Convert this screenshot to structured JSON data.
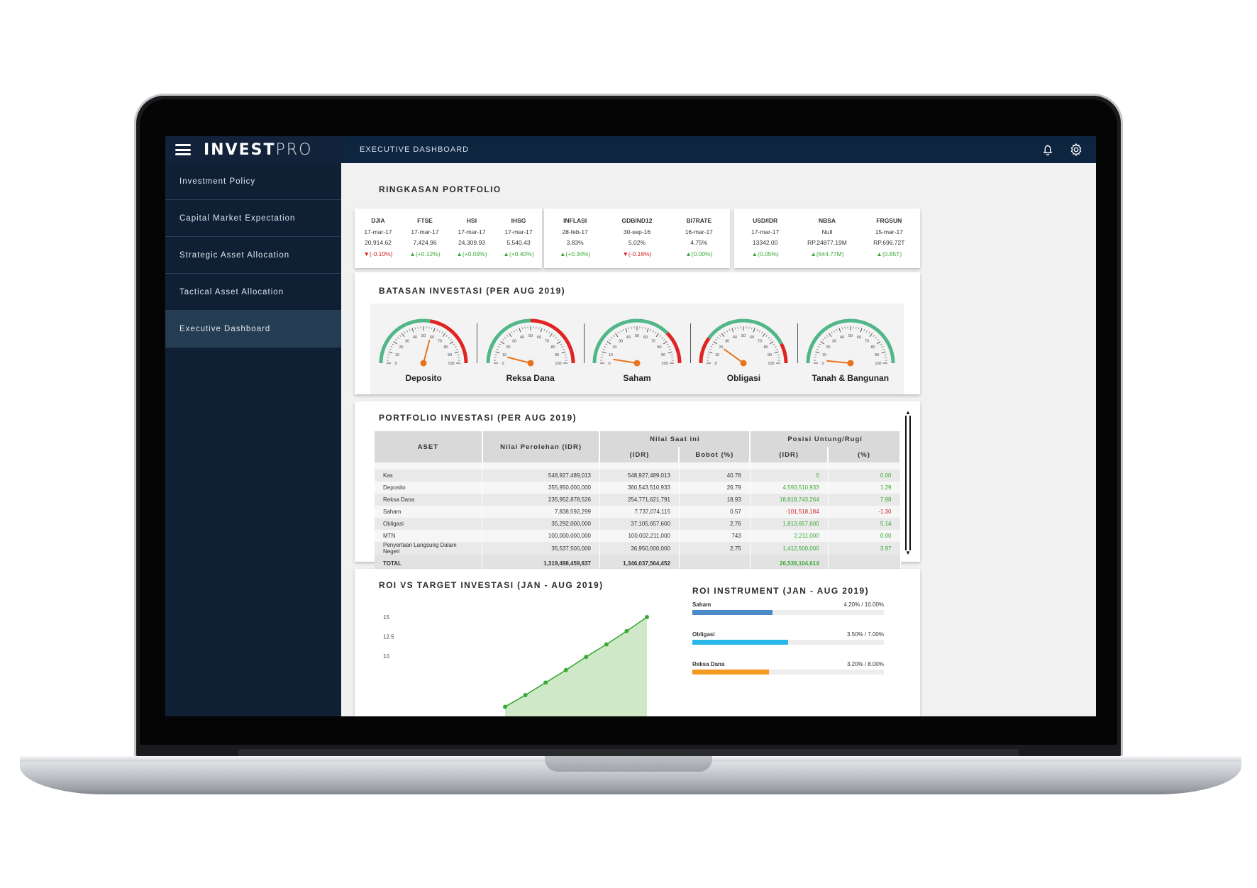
{
  "app": {
    "brand_bold": "INVEST",
    "brand_light": "PRO",
    "page_title": "EXECUTIVE DASHBOARD"
  },
  "icons": {
    "menu": "hamburger-icon",
    "notifications": "bell-icon",
    "settings": "gear-icon"
  },
  "sidebar": {
    "items": [
      {
        "label": "Investment Policy"
      },
      {
        "label": "Capital Market Expectation"
      },
      {
        "label": "Strategic Asset Allocation"
      },
      {
        "label": "Tactical Asset Allocation"
      },
      {
        "label": "Executive Dashboard",
        "active": true
      }
    ]
  },
  "ringkasan": {
    "title": "RINGKASAN PORTFOLIO",
    "groups": [
      [
        {
          "name": "DJIA",
          "date": "17-mar-17",
          "value": "20,914.62",
          "change": "(-0.10%)",
          "dir": "down"
        },
        {
          "name": "FTSE",
          "date": "17-mar-17",
          "value": "7,424.96",
          "change": "(+0.12%)",
          "dir": "up"
        },
        {
          "name": "HSI",
          "date": "17-mar-17",
          "value": "24,309.93",
          "change": "(+0.09%)",
          "dir": "up"
        },
        {
          "name": "IHSG",
          "date": "17-mar-17",
          "value": "5,540.43",
          "change": "(+0.40%)",
          "dir": "up"
        }
      ],
      [
        {
          "name": "INFLASI",
          "date": "28-feb-17",
          "value": "3.83%",
          "change": "(+0.34%)",
          "dir": "up"
        },
        {
          "name": "GDBIND12",
          "date": "30-sep-16",
          "value": "5.02%",
          "change": "(-0.16%)",
          "dir": "down"
        },
        {
          "name": "BI7RATE",
          "date": "16-mar-17",
          "value": "4.75%",
          "change": "(0.00%)",
          "dir": "up"
        }
      ],
      [
        {
          "name": "USD/IDR",
          "date": "17-mar-17",
          "value": "13342.00",
          "change": "(0.05%)",
          "dir": "up"
        },
        {
          "name": "NBSA",
          "date": "Null",
          "value": "RP.24877.19M",
          "change": "(644.77M)",
          "dir": "up"
        },
        {
          "name": "FRGSUN",
          "date": "15-mar-17",
          "value": "RP.696.72T",
          "change": "(0.85T)",
          "dir": "up"
        }
      ]
    ]
  },
  "batasan": {
    "title": "BATASAN INVESTASI (PER AUG 2019)",
    "ticks": [
      "0",
      "10",
      "20",
      "30",
      "40",
      "50",
      "60",
      "70",
      "80",
      "90",
      "100"
    ],
    "colors": {
      "green": "#52b788",
      "red": "#e02424",
      "needle": "#e8731a"
    },
    "gauges": [
      {
        "label": "Deposito",
        "value": 58,
        "green_to": 55
      },
      {
        "label": "Reksa Dana",
        "value": 8,
        "green_to": 50
      },
      {
        "label": "Saham",
        "value": 5,
        "green_to": 75
      },
      {
        "label": "Obligasi",
        "value": 20,
        "green_to": 85,
        "red_left_to": 20
      },
      {
        "label": "Tanah & Bangunan",
        "value": 3,
        "green_to": 100
      }
    ]
  },
  "portfolio": {
    "title": "PORTFOLIO INVESTASI (PER AUG 2019)",
    "headers": {
      "aset": "ASET",
      "nilai_perolehan": "Nilai Perolehan (IDR)",
      "nilai_saat_ini": "Nilai Saat ini",
      "posisi": "Posisi Untung/Rugi",
      "idr": "(IDR)",
      "bobot": "Bobot (%)",
      "pct": "(%)"
    },
    "rows": [
      {
        "aset": "Kas",
        "perolehan": "548,927,489,013",
        "saat_ini": "548,927,489,013",
        "bobot": "40.78",
        "idr": "0",
        "pct": "0.00",
        "sign": "up"
      },
      {
        "aset": "Deposito",
        "perolehan": "355,950,000,000",
        "saat_ini": "360,543,510,933",
        "bobot": "26.79",
        "idr": "4,593,510,933",
        "pct": "1.29",
        "sign": "up"
      },
      {
        "aset": "Reksa Dana",
        "perolehan": "235,952,878,526",
        "saat_ini": "254,771,621,791",
        "bobot": "18.93",
        "idr": "18,818,743,264",
        "pct": "7.98",
        "sign": "up"
      },
      {
        "aset": "Saham",
        "perolehan": "7,838,592,299",
        "saat_ini": "7,737,074,115",
        "bobot": "0.57",
        "idr": "-101,518,184",
        "pct": "-1.30",
        "sign": "down"
      },
      {
        "aset": "Obligasi",
        "perolehan": "35,292,000,000",
        "saat_ini": "37,105,657,600",
        "bobot": "2.76",
        "idr": "1,813,657,600",
        "pct": "5.14",
        "sign": "up"
      },
      {
        "aset": "MTN",
        "perolehan": "100,000,000,000",
        "saat_ini": "100,002,211,000",
        "bobot": "743",
        "idr": "2,211,000",
        "pct": "0.00",
        "sign": "up"
      },
      {
        "aset": "Penyertaan Langsung Dalam Negeri",
        "perolehan": "35,537,500,000",
        "saat_ini": "36,950,000,000",
        "bobot": "2.75",
        "idr": "1,412,500,000",
        "pct": "3.97",
        "sign": "up"
      }
    ],
    "total": {
      "label": "TOTAL",
      "perolehan": "1,319,498,459,837",
      "saat_ini": "1,346,037,564,452",
      "idr": "26,539,104,614"
    },
    "scroll_up": "▲",
    "scroll_down": "▼"
  },
  "roi": {
    "title": "ROI VS TARGET INVESTASI (JAN - AUG 2019)",
    "chart_data": {
      "type": "area",
      "y_ticks": [
        "15",
        "12.5",
        "10"
      ],
      "ylim": [
        0,
        15
      ],
      "x": [
        1,
        2,
        3,
        4,
        5,
        6,
        7,
        8
      ],
      "values": [
        3.5,
        5.0,
        6.6,
        8.2,
        9.9,
        11.5,
        13.2,
        15.0
      ],
      "color": "#3aaa35",
      "fill": "#cfe8c8"
    }
  },
  "roi_instrument": {
    "title": "ROI INSTRUMENT (JAN - AUG 2019)",
    "items": [
      {
        "name": "Saham",
        "text": "4.20% / 10.00%",
        "fraction": 0.42,
        "color": "#4a8bc8"
      },
      {
        "name": "Obligasi",
        "text": "3.50% / 7.00%",
        "fraction": 0.5,
        "color": "#29b6e8"
      },
      {
        "name": "Reksa Dana",
        "text": "3.20% / 8.00%",
        "fraction": 0.4,
        "color": "#f39a1e"
      }
    ]
  }
}
